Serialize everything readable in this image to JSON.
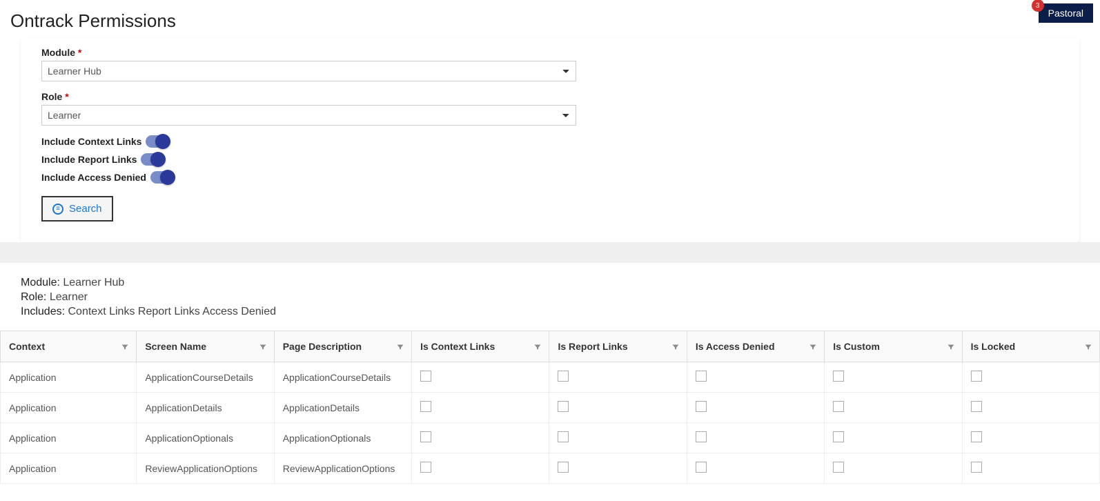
{
  "page": {
    "title": "Ontrack Permissions"
  },
  "topRight": {
    "badge": "3",
    "label": "Pastoral"
  },
  "form": {
    "module": {
      "label": "Module",
      "value": "Learner Hub"
    },
    "role": {
      "label": "Role",
      "value": "Learner"
    },
    "toggles": {
      "contextLinks": {
        "label": "Include Context Links"
      },
      "reportLinks": {
        "label": "Include Report Links"
      },
      "accessDenied": {
        "label": "Include Access Denied"
      }
    },
    "searchLabel": "Search"
  },
  "summary": {
    "moduleLabel": "Module:",
    "moduleValue": "Learner Hub",
    "roleLabel": "Role:",
    "roleValue": "Learner",
    "includesLabel": "Includes:",
    "includesValue": "Context Links  Report Links  Access Denied"
  },
  "grid": {
    "headers": {
      "context": "Context",
      "screenName": "Screen Name",
      "pageDescription": "Page Description",
      "isContextLinks": "Is Context Links",
      "isReportLinks": "Is Report Links",
      "isAccessDenied": "Is Access Denied",
      "isCustom": "Is Custom",
      "isLocked": "Is Locked"
    },
    "rows": [
      {
        "context": "Application",
        "screenName": "ApplicationCourseDetails",
        "pageDescription": "ApplicationCourseDetails"
      },
      {
        "context": "Application",
        "screenName": "ApplicationDetails",
        "pageDescription": "ApplicationDetails"
      },
      {
        "context": "Application",
        "screenName": "ApplicationOptionals",
        "pageDescription": "ApplicationOptionals"
      },
      {
        "context": "Application",
        "screenName": "ReviewApplicationOptions",
        "pageDescription": "ReviewApplicationOptions"
      }
    ]
  }
}
